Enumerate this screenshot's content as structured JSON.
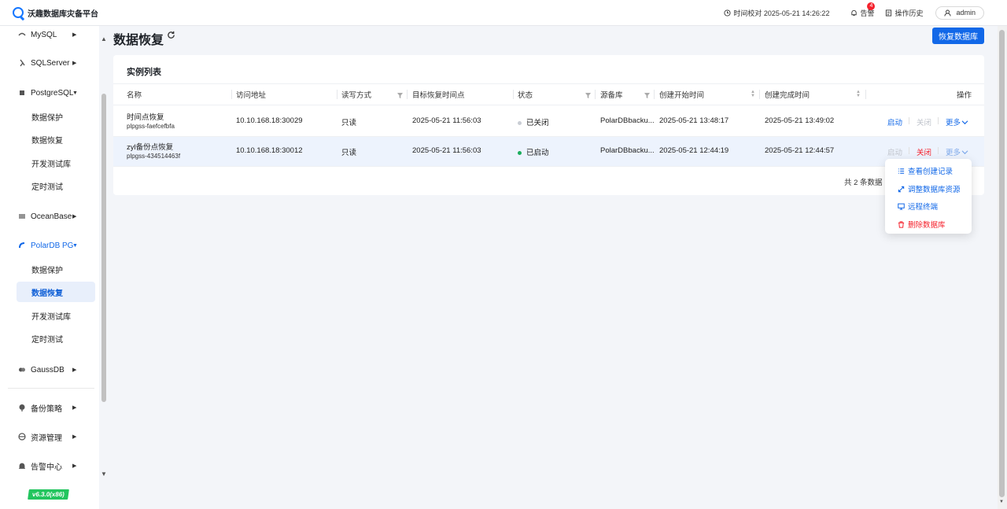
{
  "header": {
    "app_title": "沃趣数据库灾备平台",
    "time_label": "时间校对 2025-05-21 14:26:22",
    "alarm_label": "告警",
    "alarm_count": "4",
    "history_label": "操作历史",
    "user": "admin"
  },
  "sidebar": {
    "groups": [
      {
        "label": "MySQL",
        "icon": "mysql-icon"
      },
      {
        "label": "SQLServer",
        "icon": "sqlserver-icon"
      },
      {
        "label": "PostgreSQL",
        "icon": "postgresql-icon"
      },
      {
        "label": "OceanBase",
        "icon": "oceanbase-icon"
      },
      {
        "label": "PolarDB PG",
        "icon": "polardb-icon"
      },
      {
        "label": "GaussDB",
        "icon": "gaussdb-icon"
      },
      {
        "label": "备份策略",
        "icon": "strategy-icon"
      },
      {
        "label": "资源管理",
        "icon": "resource-icon"
      },
      {
        "label": "告警中心",
        "icon": "alarm-center-icon"
      }
    ],
    "postgresql_items": [
      "数据保护",
      "数据恢复",
      "开发测试库",
      "定时测试"
    ],
    "polardb_items": [
      "数据保护",
      "数据恢复",
      "开发测试库",
      "定时测试"
    ],
    "active_item": "数据恢复",
    "version": "v6.3.0(x86)"
  },
  "page": {
    "title": "数据恢复",
    "primary_button": "恢复数据库"
  },
  "card": {
    "title": "实例列表",
    "columns": [
      "名称",
      "访问地址",
      "读写方式",
      "目标恢复时间点",
      "状态",
      "源备库",
      "创建开始时间",
      "创建完成时间",
      "操作"
    ],
    "rows": [
      {
        "name": "时间点恢复",
        "id": "plpgss-faefcefbfa",
        "address": "10.10.168.18:30029",
        "rw": "只读",
        "target_time": "2025-05-21 11:56:03",
        "status": "已关闭",
        "status_color": "#c9cdd4",
        "source": "PolarDBbacku...",
        "start_time": "2025-05-21 13:48:17",
        "end_time": "2025-05-21 13:49:02",
        "actions": {
          "start": "启动",
          "stop": "关闭",
          "more": "更多"
        }
      },
      {
        "name": "zyl备份点恢复",
        "id": "plpgss-434514463f",
        "address": "10.10.168.18:30012",
        "rw": "只读",
        "target_time": "2025-05-21 11:56:03",
        "status": "已启动",
        "status_color": "#1aad5c",
        "source": "PolarDBbacku...",
        "start_time": "2025-05-21 12:44:19",
        "end_time": "2025-05-21 12:44:57",
        "actions": {
          "start": "启动",
          "stop": "关闭",
          "more": "更多"
        }
      }
    ],
    "pagination": "共 2 条数据"
  },
  "dropdown": {
    "items": [
      "查看创建记录",
      "调整数据库资源",
      "远程终端",
      "删除数据库"
    ]
  },
  "colors": {
    "primary": "#1268e8",
    "danger": "#f5222d",
    "success": "#1aad5c"
  }
}
